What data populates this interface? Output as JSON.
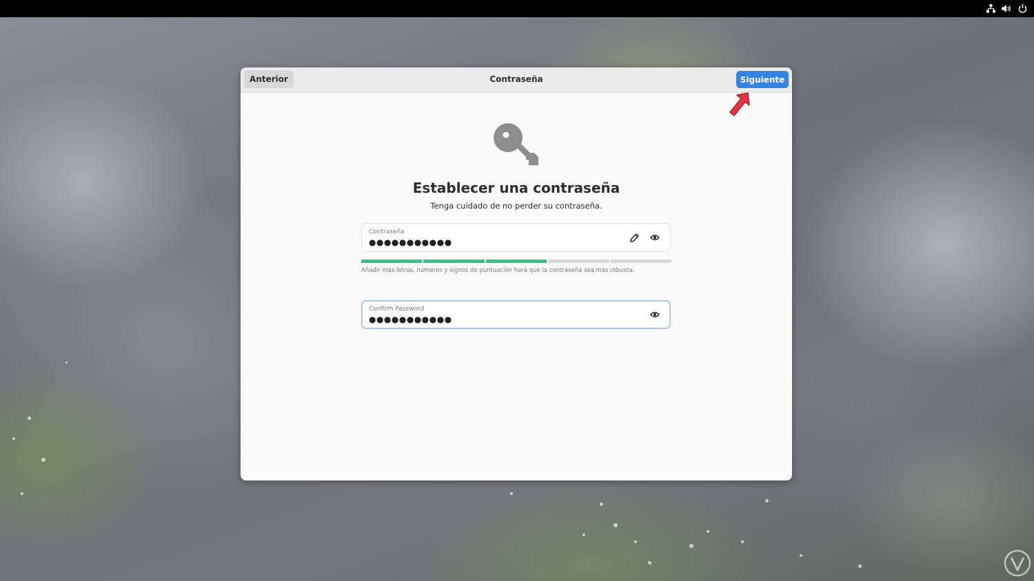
{
  "topbar": {
    "icons": [
      "network-icon",
      "volume-icon",
      "power-icon"
    ]
  },
  "dialog": {
    "back_label": "Anterior",
    "title": "Contraseña",
    "next_label": "Siguiente",
    "heading": "Establecer una contraseña",
    "subheading": "Tenga cuidado de no perder su contraseña.",
    "password_field": {
      "label": "Contraseña",
      "value": "●●●●●●●●●●●"
    },
    "strength": {
      "level": 0.6,
      "segments_total": 5,
      "segments_filled": 3,
      "hint": "Añadir más letras, números y signos de puntuación hará que la contraseña sea más robusta."
    },
    "confirm_field": {
      "label": "Confirm Password",
      "value": "●●●●●●●●●●●"
    }
  },
  "colors": {
    "accent": "#3584e4",
    "strength_filled": "#33c281",
    "strength_empty": "#d6d6d6",
    "annotation_arrow": "#e8343d"
  }
}
